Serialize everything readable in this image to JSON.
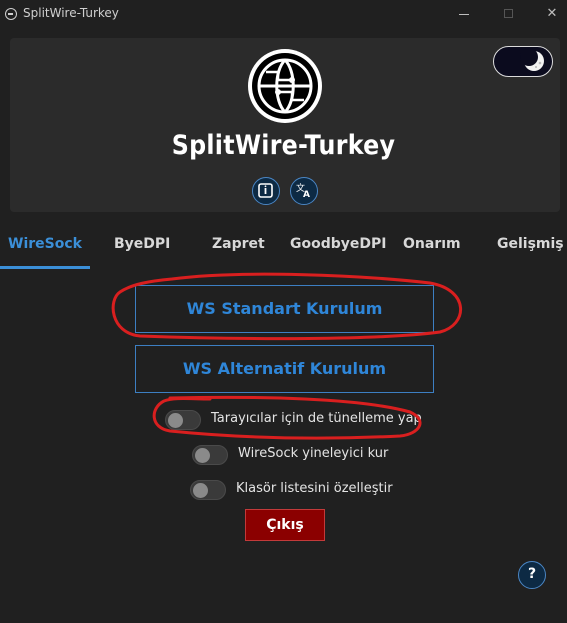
{
  "window": {
    "title": "SplitWire-Turkey",
    "minimize_glyph": "—",
    "maximize_glyph": "☐",
    "close_glyph": "✕"
  },
  "header": {
    "app_title": "SplitWire-Turkey",
    "logo_icon": "globe-network-icon",
    "info_icon": "info-icon",
    "translate_icon": "translate-icon",
    "theme_icon": "moon-icon"
  },
  "tabs": [
    {
      "label": "WireSock",
      "active": true
    },
    {
      "label": "ByeDPI",
      "active": false
    },
    {
      "label": "Zapret",
      "active": false
    },
    {
      "label": "GoodbyeDPI",
      "active": false
    },
    {
      "label": "Onarım",
      "active": false
    },
    {
      "label": "Gelişmiş",
      "active": false
    }
  ],
  "main": {
    "standard_install_label": "WS Standart Kurulum",
    "alternative_install_label": "WS Alternatif Kurulum",
    "toggles": [
      {
        "label": "Tarayıcılar için de tünelleme yap",
        "on": false
      },
      {
        "label": "WireSock yineleyici kur",
        "on": false
      },
      {
        "label": "Klasör listesini özelleştir",
        "on": false
      }
    ],
    "exit_label": "Çıkış",
    "help_label": "?"
  },
  "colors": {
    "accent": "#3b8fd8",
    "exit": "#8b0000",
    "annotation": "#d91f1f",
    "background": "#202020",
    "card": "#2b2b2b"
  }
}
